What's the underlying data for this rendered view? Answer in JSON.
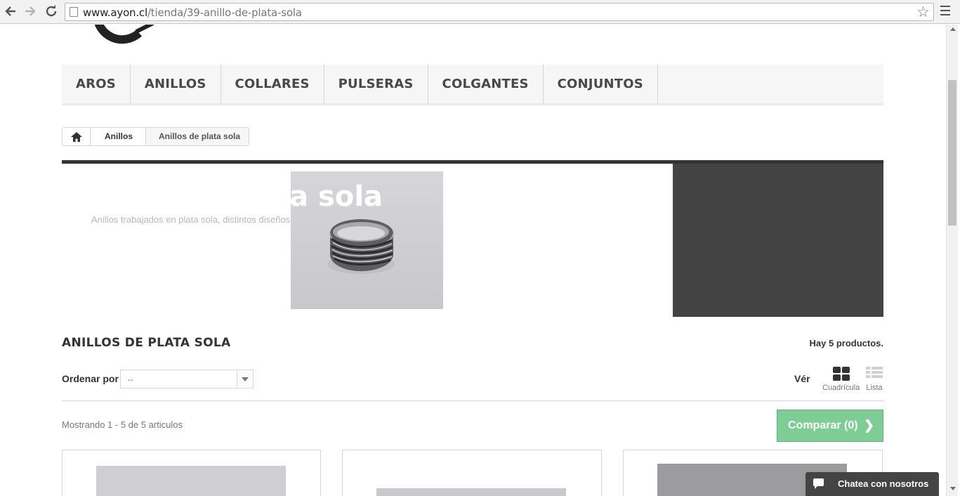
{
  "browser": {
    "url_host": "www.ayon.cl",
    "url_path": "/tienda/39-anillo-de-plata-sola",
    "back_icon": "arrow-left",
    "forward_icon": "arrow-right",
    "reload_icon": "reload",
    "star_icon": "star-outline"
  },
  "menu": {
    "items": [
      "AROS",
      "ANILLOS",
      "COLLARES",
      "PULSERAS",
      "COLGANTES",
      "CONJUNTOS"
    ]
  },
  "breadcrumb": {
    "home_icon": "home",
    "items": [
      "Anillos",
      "Anillos de plata sola"
    ]
  },
  "banner": {
    "title": "ta sola",
    "description": "Anillos trabajados en plata sola, distintos diseños y tama"
  },
  "category": {
    "heading": "ANILLOS DE PLATA SOLA",
    "count": "Hay 5 productos."
  },
  "sort": {
    "label": "Ordenar por",
    "value": "--"
  },
  "view": {
    "label": "Vér",
    "grid_label": "Cuadrícula",
    "list_label": "Lista"
  },
  "results": {
    "showing": "Mostrando 1 - 5 de 5 articulos",
    "compare": "Comparar (0)"
  },
  "chat": {
    "label": "Chatea con nosotros"
  },
  "colors": {
    "compare_bg": "#7dcd94",
    "banner_dark": "#434343",
    "chat_bg": "#444444"
  }
}
